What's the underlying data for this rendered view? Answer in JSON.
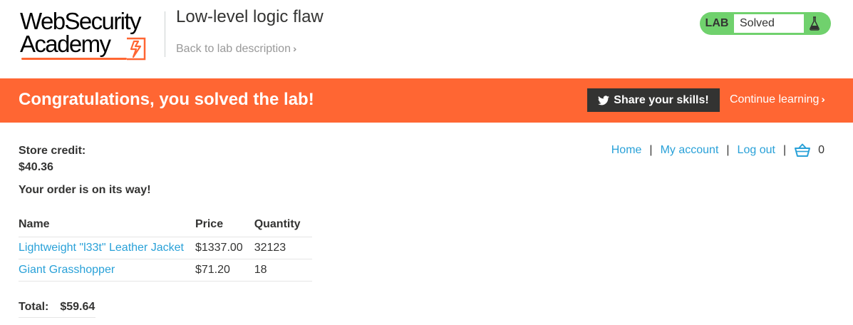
{
  "header": {
    "logo_line1": "WebSecurity",
    "logo_line2": "Academy",
    "lab_title": "Low-level logic flaw",
    "back_link": "Back to lab description",
    "lab_tag": "LAB",
    "lab_status": "Solved"
  },
  "banner": {
    "message": "Congratulations, you solved the lab!",
    "share_label": "Share your skills!",
    "continue_label": "Continue learning"
  },
  "account": {
    "store_credit_label": "Store credit:",
    "store_credit_value": "$40.36",
    "order_message": "Your order is on its way!"
  },
  "nav": {
    "home": "Home",
    "my_account": "My account",
    "log_out": "Log out",
    "separator": "|",
    "cart_count": "0"
  },
  "order_table": {
    "headers": [
      "Name",
      "Price",
      "Quantity"
    ],
    "rows": [
      {
        "name": "Lightweight \"l33t\" Leather Jacket",
        "price": "$1337.00",
        "quantity": "32123"
      },
      {
        "name": "Giant Grasshopper",
        "price": "$71.20",
        "quantity": "18"
      }
    ],
    "total_label": "Total:",
    "total_value": "$59.64"
  },
  "colors": {
    "brand_orange": "#ff6633",
    "lab_solved_green": "#70d16d",
    "link_blue": "#29a1d8",
    "dark": "#333332"
  }
}
